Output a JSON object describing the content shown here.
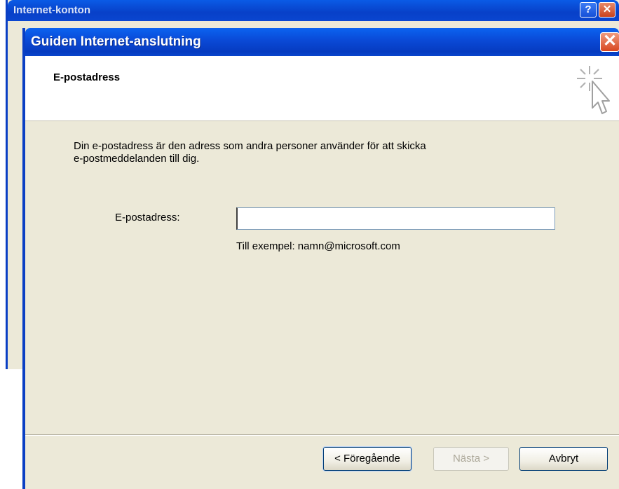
{
  "background_window": {
    "title": "Internet-konton",
    "help_label": "?",
    "close_label": "✕"
  },
  "wizard": {
    "title": "Guiden Internet-anslutning",
    "close_label": "✕",
    "heading": "E-postadress",
    "description_lines": [
      "Din e-postadress är den adress som andra personer använder för att skicka",
      "e-postmeddelanden till dig."
    ],
    "email_label": "E-postadress:",
    "email_value": "",
    "example_text": "Till exempel: namn@microsoft.com",
    "buttons": {
      "back": "< Föregående",
      "next": "Nästa >",
      "cancel": "Avbryt"
    },
    "header_icon": "cursor-sparkle-icon"
  },
  "colors": {
    "titlebar_blue": "#0a49d6",
    "dialog_bg": "#ece9d8",
    "close_red": "#d8461f",
    "disabled_text": "#aca899"
  }
}
